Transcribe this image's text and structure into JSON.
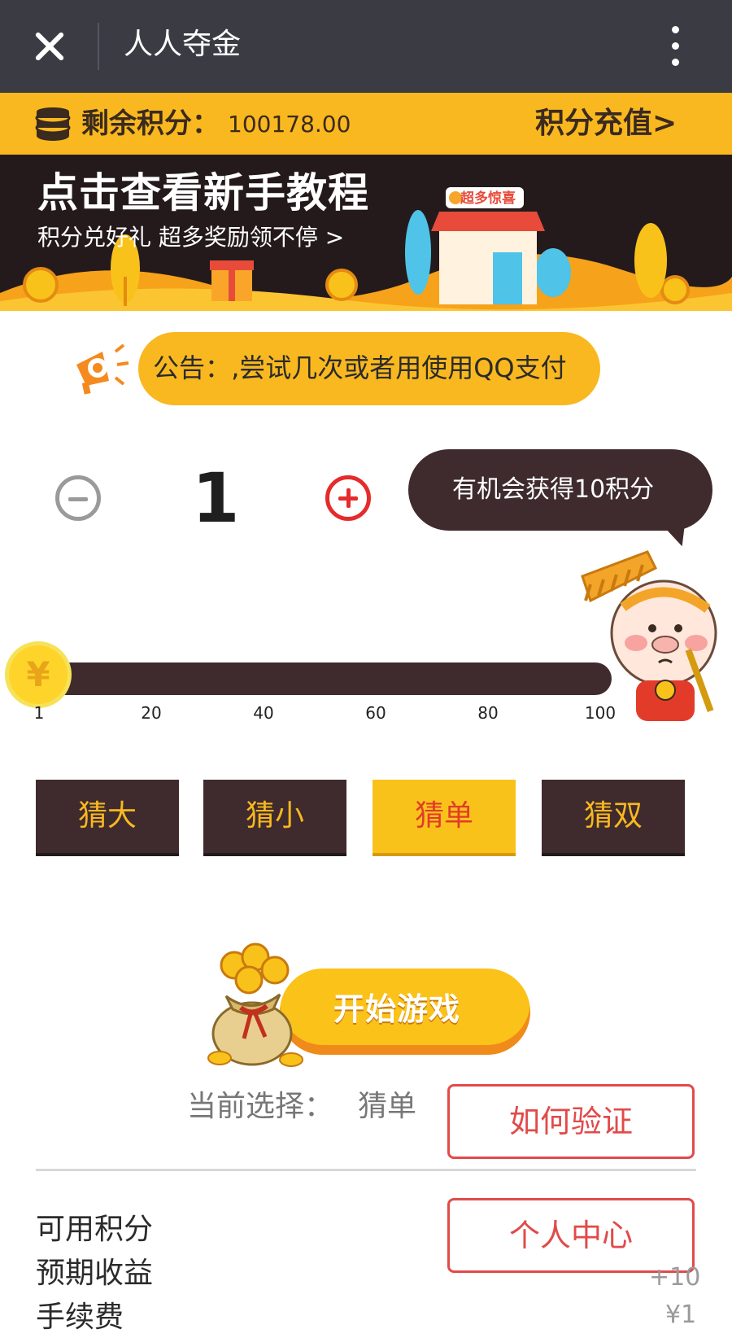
{
  "titlebar": {
    "title": "人人夺金",
    "close_icon": "close-icon",
    "more_icon": "more-vertical-icon"
  },
  "points": {
    "label": "剩余积分：",
    "value": "100178.00",
    "recharge": "积分充值>",
    "icon": "coin-stack-icon"
  },
  "banner": {
    "title": "点击查看新手教程",
    "subtitle": "积分兑好礼 超多奖励领不停   >",
    "shop_sign": "超多惊喜"
  },
  "notice": {
    "label": "公告：",
    "text": "‚尝试几次或者用使用QQ支付"
  },
  "stepper": {
    "value": "1",
    "tip": "有机会获得10积分"
  },
  "slider": {
    "value": 1,
    "knob_glyph": "¥",
    "ticks": [
      "1",
      "20",
      "40",
      "60",
      "80",
      "100"
    ]
  },
  "guess": {
    "options": [
      "猜大",
      "猜小",
      "猜单",
      "猜双"
    ],
    "selected_index": 2
  },
  "start": {
    "label": "开始游戏"
  },
  "selection": {
    "label": "当前选择：",
    "value": "猜单"
  },
  "buttons": {
    "verify": "如何验证",
    "profile": "个人中心"
  },
  "stats": {
    "available_label": "可用积分",
    "expected_label": "预期收益",
    "expected_value": "+10",
    "fee_label": "手续费",
    "fee_value": "¥1"
  },
  "colors": {
    "accent_yellow": "#f9b81f",
    "dark_brown": "#3f2b2e",
    "titlebar": "#3b3b44",
    "red": "#e24a4a"
  }
}
